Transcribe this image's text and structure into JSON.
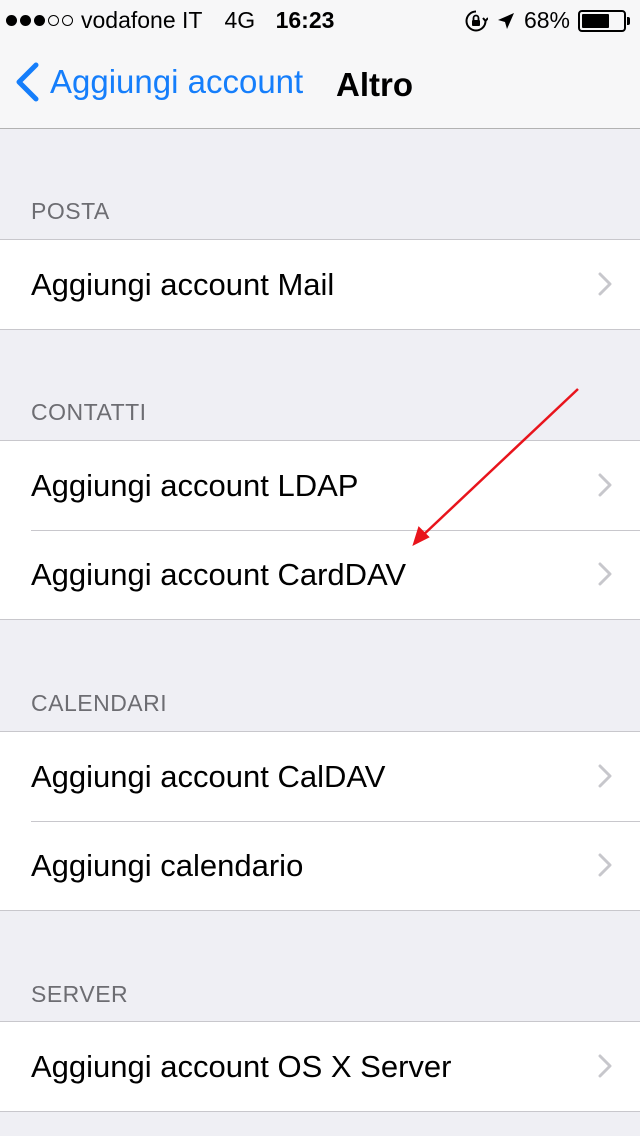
{
  "status_bar": {
    "carrier": "vodafone IT",
    "network": "4G",
    "time": "16:23",
    "battery": "68%",
    "battery_level": 0.68,
    "signal_bars": 3
  },
  "nav": {
    "back_label": "Aggiungi account",
    "title": "Altro"
  },
  "sections": [
    {
      "header": "POSTA",
      "items": [
        "Aggiungi account Mail"
      ]
    },
    {
      "header": "CONTATTI",
      "items": [
        "Aggiungi account LDAP",
        "Aggiungi account CardDAV"
      ]
    },
    {
      "header": "CALENDARI",
      "items": [
        "Aggiungi account CalDAV",
        "Aggiungi calendario"
      ]
    },
    {
      "header": "SERVER",
      "items": [
        "Aggiungi account OS X Server"
      ]
    }
  ],
  "colors": {
    "accent": "#157efb",
    "annotation_arrow": "#e8141c"
  },
  "icons": [
    "chevron-left-icon",
    "chevron-right-icon",
    "orientation-lock-icon",
    "location-arrow-icon",
    "battery-icon"
  ]
}
